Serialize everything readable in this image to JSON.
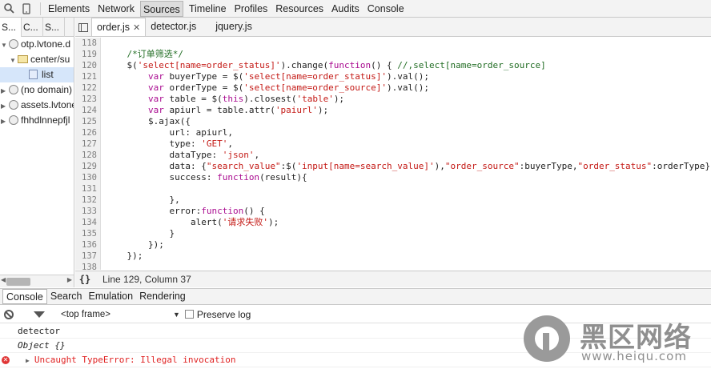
{
  "toolbar": {
    "tabs": [
      "Elements",
      "Network",
      "Sources",
      "Timeline",
      "Profiles",
      "Resources",
      "Audits",
      "Console"
    ],
    "active_tab": "Sources"
  },
  "sidebar": {
    "tabs": [
      "S...",
      "C...",
      "S..."
    ],
    "tree": [
      {
        "label": "otp.lvtone.d",
        "type": "globe",
        "expanded": true,
        "level": 0
      },
      {
        "label": "center/su",
        "type": "folder",
        "expanded": true,
        "level": 1
      },
      {
        "label": "list",
        "type": "file",
        "level": 2,
        "selected": true
      },
      {
        "label": "(no domain)",
        "type": "globe",
        "expanded": false,
        "level": 0
      },
      {
        "label": "assets.lvtone",
        "type": "globe",
        "expanded": false,
        "level": 0
      },
      {
        "label": "fhhdlnnepfjl",
        "type": "globe",
        "expanded": false,
        "level": 0
      }
    ]
  },
  "editor": {
    "tabs": [
      {
        "label": "order.js",
        "active": true,
        "closable": true
      },
      {
        "label": "detector.js",
        "active": false
      },
      {
        "label": "jquery.js",
        "active": false
      }
    ],
    "line_numbers": [
      "118",
      "119",
      "120",
      "121",
      "122",
      "123",
      "124",
      "125",
      "126",
      "127",
      "128",
      "129",
      "130",
      "131",
      "132",
      "133",
      "134",
      "135",
      "136",
      "137",
      "138"
    ],
    "code_lines": [
      "",
      "    /*订单筛选*/",
      "    $('select[name=order_status]').change(function() { //,select[name=order_source]",
      "        var buyerType = $('select[name=order_status]').val();",
      "        var orderType = $('select[name=order_source]').val();",
      "        var table = $(this).closest('table');",
      "        var apiurl = table.attr('paiurl');",
      "        $.ajax({",
      "            url: apiurl,",
      "            type: 'GET',",
      "            dataType: 'json',",
      "            data: {\"search_value\":$('input[name=search_value]'),\"order_source\":buyerType,\"order_status\":orderType},",
      "            success: function(result){",
      "",
      "            },",
      "            error:function() {",
      "                alert('请求失败');",
      "            }",
      "        });",
      "    });",
      ""
    ],
    "status_braces": "{}",
    "cursor_position": "Line 129, Column 37"
  },
  "drawer": {
    "tabs": [
      "Console",
      "Search",
      "Emulation",
      "Rendering"
    ],
    "active_tab": "Console",
    "frame_selector": "<top frame>",
    "preserve_log_label": "Preserve log",
    "messages": [
      {
        "text": "detector",
        "level": "log"
      },
      {
        "text": "Object {}",
        "level": "object"
      },
      {
        "text": "Uncaught TypeError: Illegal invocation",
        "level": "error"
      }
    ]
  },
  "watermark": {
    "title": "黑区网络",
    "url": "www.heiqu.com"
  },
  "colors": {
    "keyword": "#aa0d91",
    "string": "#c41a16",
    "comment": "#236e25",
    "error": "#e02222"
  }
}
